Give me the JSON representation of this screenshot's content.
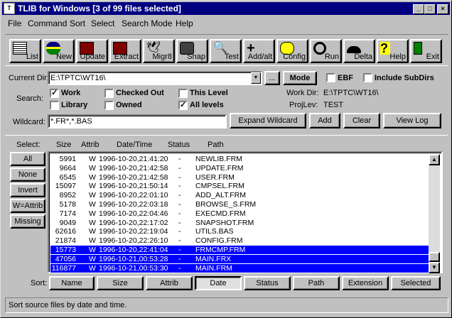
{
  "window": {
    "title": "TLIB for Windows [3 of 99 files selected]",
    "title_icon": "tlib-app-icon",
    "min": "_",
    "max": "□",
    "close": "×"
  },
  "menu": [
    "File",
    "Command",
    "Sort",
    "Select",
    "Search Mode",
    "Help"
  ],
  "toolbar": [
    {
      "label": "List",
      "icon": "list-icon"
    },
    {
      "label": "New",
      "icon": "new-icon"
    },
    {
      "label": "Update",
      "icon": "update-icon"
    },
    {
      "label": "Extract",
      "icon": "extract-icon"
    },
    {
      "label": "Migr8",
      "icon": "migrate-icon"
    },
    {
      "label": "Snap",
      "icon": "camera-icon"
    },
    {
      "label": "Test",
      "icon": "magnifier-icon"
    },
    {
      "label": "Add/alt",
      "icon": "plus-icon"
    },
    {
      "label": "Config",
      "icon": "key-icon"
    },
    {
      "label": "Run",
      "icon": "steering-wheel-icon"
    },
    {
      "label": "Delta",
      "icon": "car-icon"
    },
    {
      "label": "Help",
      "icon": "question-icon"
    },
    {
      "label": "Exit",
      "icon": "exit-icon"
    }
  ],
  "current_dir": {
    "label": "Current Dir:",
    "value": "E:\\TPTC\\WT16\\",
    "browse": "...",
    "mode": "Mode"
  },
  "options": {
    "ebf": "EBF",
    "include_subdirs": "Include SubDirs"
  },
  "search": {
    "label": "Search:",
    "work": "Work",
    "library": "Library",
    "checked_out": "Checked Out",
    "owned": "Owned",
    "this_level": "This Level",
    "all_levels": "All levels",
    "work_checked": true,
    "library_checked": false,
    "checked_out_checked": false,
    "owned_checked": false,
    "this_level_checked": false,
    "all_levels_checked": true
  },
  "work_dir": {
    "label": "Work Dir:",
    "value": "E:\\TPTC\\WT16\\"
  },
  "proj_lev": {
    "label": "ProjLev:",
    "value": "TEST"
  },
  "wildcard": {
    "label": "Wildcard:",
    "value": "*.FR*,*.BAS",
    "expand": "Expand Wildcard",
    "add": "Add",
    "clear": "Clear",
    "view_log": "View Log"
  },
  "select": {
    "label": "Select:",
    "buttons": [
      "All",
      "None",
      "Invert",
      "W=Attrib",
      "Missing"
    ]
  },
  "columns": [
    "Size",
    "Attrib",
    "Date/Time",
    "Status",
    "Path"
  ],
  "rows": [
    {
      "size": "5991",
      "attrib": "W",
      "dt": "1996-10-20,21:41:20",
      "status": "-",
      "path": "NEWLIB.FRM",
      "selected": false
    },
    {
      "size": "9664",
      "attrib": "W",
      "dt": "1996-10-20,21:42:58",
      "status": "-",
      "path": "UPDATE.FRM",
      "selected": false
    },
    {
      "size": "6545",
      "attrib": "W",
      "dt": "1996-10-20,21:42:58",
      "status": "-",
      "path": "USER.FRM",
      "selected": false
    },
    {
      "size": "15097",
      "attrib": "W",
      "dt": "1996-10-20,21:50:14",
      "status": "-",
      "path": "CMPSEL.FRM",
      "selected": false
    },
    {
      "size": "8952",
      "attrib": "W",
      "dt": "1996-10-20,22:01:10",
      "status": "-",
      "path": "ADD_ALT.FRM",
      "selected": false
    },
    {
      "size": "5178",
      "attrib": "W",
      "dt": "1996-10-20,22:03:18",
      "status": "-",
      "path": "BROWSE_S.FRM",
      "selected": false
    },
    {
      "size": "7174",
      "attrib": "W",
      "dt": "1996-10-20,22:04:46",
      "status": "-",
      "path": "EXECMD.FRM",
      "selected": false
    },
    {
      "size": "9049",
      "attrib": "W",
      "dt": "1996-10-20,22:17:02",
      "status": "-",
      "path": "SNAPSHOT.FRM",
      "selected": false
    },
    {
      "size": "62616",
      "attrib": "W",
      "dt": "1996-10-20,22:19:04",
      "status": "-",
      "path": "UTILS.BAS",
      "selected": false
    },
    {
      "size": "21874",
      "attrib": "W",
      "dt": "1996-10-20,22:26:10",
      "status": "-",
      "path": "CONFIG.FRM",
      "selected": false
    },
    {
      "size": "15773",
      "attrib": "W",
      "dt": "1996-10-20,22:41:04",
      "status": "-",
      "path": "FRMCMP.FRM",
      "selected": true
    },
    {
      "size": "47056",
      "attrib": "W",
      "dt": "1996-10-21,00:53:28",
      "status": "-",
      "path": "MAIN.FRX",
      "selected": true
    },
    {
      "size": "116877",
      "attrib": "W",
      "dt": "1996-10-21,00:53:30",
      "status": "-",
      "path": "MAIN.FRM",
      "selected": true
    }
  ],
  "sort": {
    "label": "Sort:",
    "buttons": [
      "Name",
      "Size",
      "Attrib",
      "Date",
      "Status",
      "Path",
      "Extension",
      "Selected"
    ],
    "active": "Date"
  },
  "status": "Sort source files by date and time.",
  "colors": {
    "title_bg": "#000080",
    "selection": "#0000ff",
    "face": "#c0c0c0"
  }
}
